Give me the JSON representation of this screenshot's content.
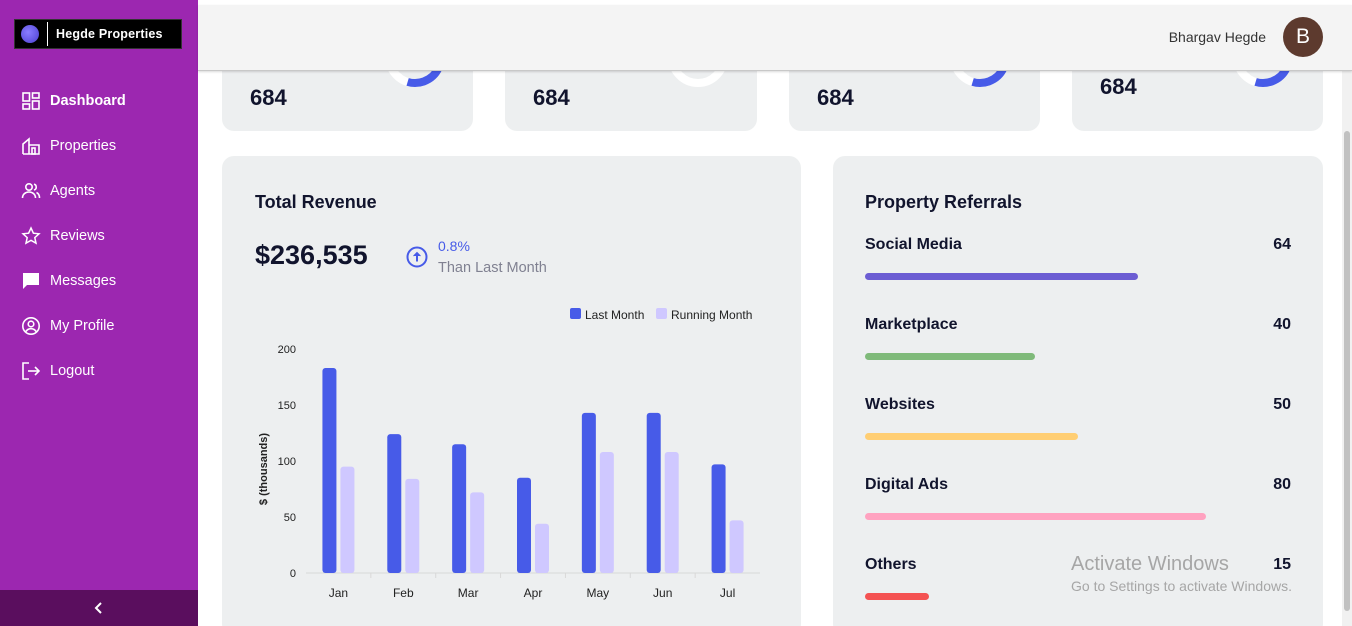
{
  "brand": {
    "name": "Hegde Properties"
  },
  "sidebar": {
    "items": [
      {
        "label": "Dashboard",
        "icon": "dashboard-icon",
        "active": true
      },
      {
        "label": "Properties",
        "icon": "building-icon",
        "active": false
      },
      {
        "label": "Agents",
        "icon": "people-icon",
        "active": false
      },
      {
        "label": "Reviews",
        "icon": "star-icon",
        "active": false
      },
      {
        "label": "Messages",
        "icon": "message-icon",
        "active": false
      },
      {
        "label": "My Profile",
        "icon": "profile-icon",
        "active": false
      },
      {
        "label": "Logout",
        "icon": "logout-icon",
        "active": false
      }
    ],
    "collapse_icon": "chevron-left-icon",
    "color": "#9c27b0"
  },
  "header": {
    "user_name": "Bhargav Hegde",
    "avatar_initial": "B"
  },
  "stats": [
    {
      "value": "684",
      "progress": 0.85
    },
    {
      "value": "684",
      "progress": 0.6
    },
    {
      "value": "684",
      "progress": 0.85
    },
    {
      "value": "684",
      "progress": 0.85
    }
  ],
  "revenue": {
    "title": "Total Revenue",
    "amount": "$236,535",
    "change": "0.8%",
    "change_label": "Than Last Month",
    "change_icon": "arrow-up-circle-icon"
  },
  "chart_data": {
    "type": "bar",
    "categories": [
      "Jan",
      "Feb",
      "Mar",
      "Apr",
      "May",
      "Jun",
      "Jul"
    ],
    "series": [
      {
        "name": "Last Month",
        "color": "#475be8",
        "values": [
          183,
          124,
          115,
          85,
          143,
          143,
          97
        ]
      },
      {
        "name": "Running Month",
        "color": "#cfc8ff",
        "values": [
          95,
          84,
          72,
          44,
          108,
          108,
          47
        ]
      }
    ],
    "ylabel": "$ (thousands)",
    "yticks": [
      0,
      50,
      100,
      150,
      200
    ],
    "ylim": [
      0,
      200
    ],
    "legend": "top-right"
  },
  "referrals": {
    "title": "Property Referrals",
    "items": [
      {
        "label": "Social Media",
        "value": "64",
        "percent": 64,
        "color": "#6c5dd3"
      },
      {
        "label": "Marketplace",
        "value": "40",
        "percent": 40,
        "color": "#7fba7a"
      },
      {
        "label": "Websites",
        "value": "50",
        "percent": 50,
        "color": "#ffce73"
      },
      {
        "label": "Digital Ads",
        "value": "80",
        "percent": 80,
        "color": "#ffa2c0"
      },
      {
        "label": "Others",
        "value": "15",
        "percent": 15,
        "color": "#f45252"
      }
    ]
  },
  "watermark": {
    "title": "Activate Windows",
    "subtitle": "Go to Settings to activate Windows."
  }
}
